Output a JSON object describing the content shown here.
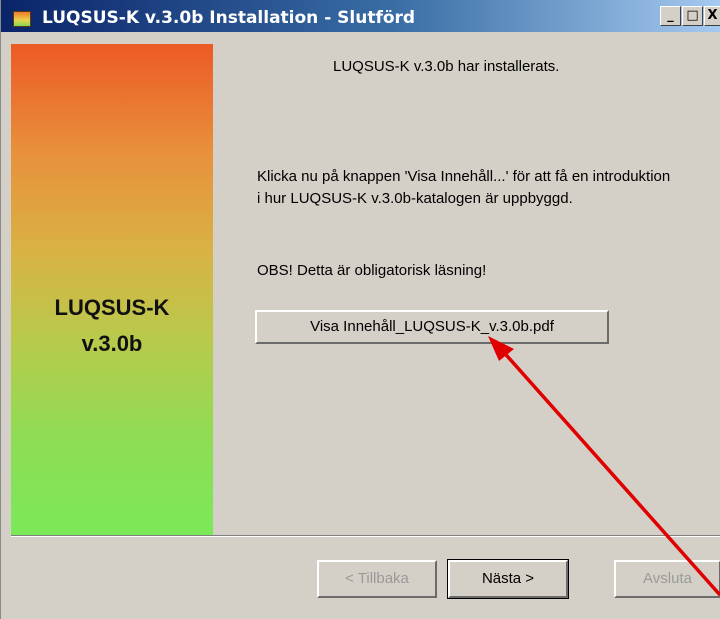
{
  "window": {
    "title": "LUQSUS-K v.3.0b Installation - Slutförd",
    "icon": "installer-app-icon",
    "controls": {
      "minimize": "_",
      "maximize": "□",
      "close": "X"
    }
  },
  "sidebar": {
    "product_name": "LUQSUS-K",
    "version": "v.3.0b",
    "gradient_colors": [
      "#ec5a24",
      "#e8903c",
      "#d9b244",
      "#b9c94c",
      "#8fdc54",
      "#7ae958"
    ]
  },
  "content": {
    "installed_message": "LUQSUS-K v.3.0b har installerats.",
    "intro_message": "Klicka nu på knappen 'Visa Innehåll...' för att få en introduktion i hur LUQSUS-K v.3.0b-katalogen är uppbyggd.",
    "obs_message": "OBS! Detta är obligatorisk läsning!",
    "pdf_button_label": "Visa Innehåll_LUQSUS-K_v.3.0b.pdf"
  },
  "footer": {
    "back_label": "< Tillbaka",
    "back_enabled": false,
    "next_label": "Nästa >",
    "next_enabled": true,
    "exit_label": "Avsluta",
    "exit_enabled": false
  },
  "annotation": {
    "arrow_color": "#e00000",
    "arrow_icon": "red-arrow-pointing-to-pdf-button"
  }
}
